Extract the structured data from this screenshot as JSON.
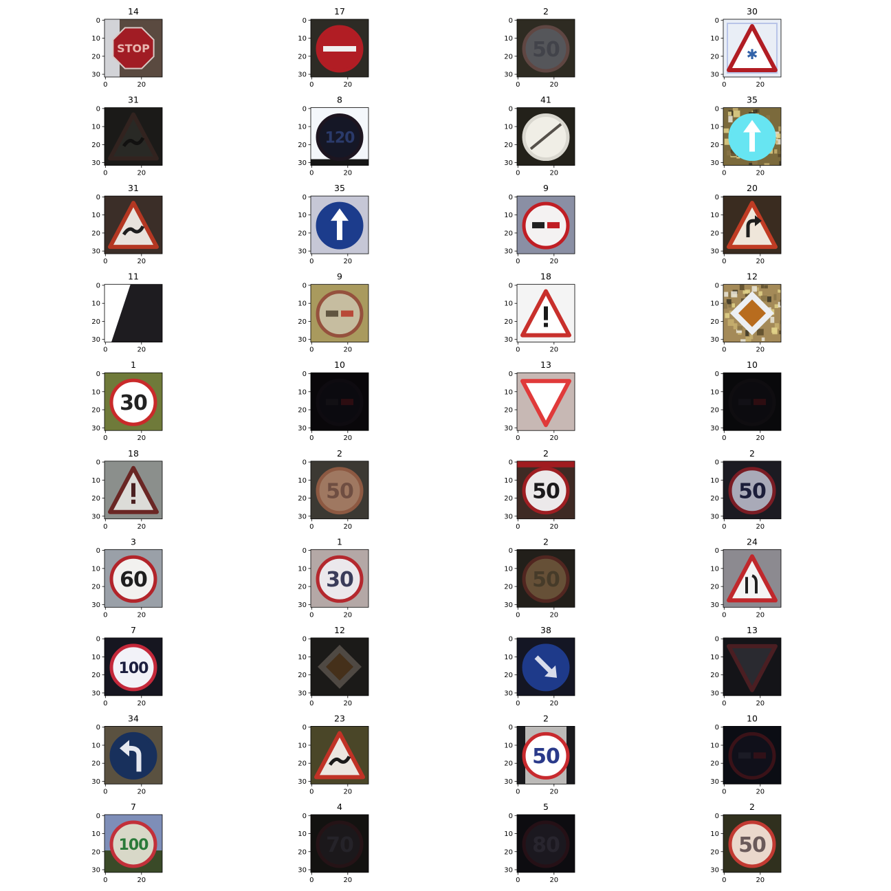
{
  "figure": {
    "axis_ticks": {
      "y": [
        "0",
        "10",
        "20",
        "30"
      ],
      "x": [
        "0",
        "20"
      ]
    },
    "panels": [
      {
        "label": "14",
        "bg": "#5a4a40",
        "shape": "octagon",
        "rim": "#a11c24",
        "fill": "#a11c24",
        "sym": "STOP",
        "symColor": "#e8b6b0",
        "light": true
      },
      {
        "label": "17",
        "bg": "#2d2b25",
        "shape": "circle",
        "rim": "#b11d24",
        "fill": "#b11d24",
        "sym": "bar",
        "symColor": "#efefef"
      },
      {
        "label": "2",
        "bg": "#2e2c23",
        "shape": "circle",
        "rim": "#7a5553",
        "fill": "#6a6d78",
        "sym": "50",
        "symColor": "#4d5160",
        "blur": true
      },
      {
        "label": "30",
        "bg": "#e9eef6",
        "shape": "triangle",
        "rim": "#b11d24",
        "fill": "#ffffff",
        "sym": "✱",
        "symColor": "#3262a8",
        "frame": true
      },
      {
        "label": "31",
        "bg": "#2a2925",
        "shape": "triangle",
        "rim": "#4d3631",
        "fill": "#403f3a",
        "sym": "~",
        "symColor": "#1c1b19",
        "dim": true
      },
      {
        "label": "8",
        "bg": "#f4f7fb",
        "shape": "circle",
        "rim": "#1d1520",
        "fill": "#151726",
        "sym": "120",
        "symColor": "#2a3a6a",
        "base": "#161616"
      },
      {
        "label": "41",
        "bg": "#23211a",
        "shape": "circle",
        "rim": "#d9d7cf",
        "fill": "#f0eee6",
        "sym": "slash",
        "symColor": "#55504a"
      },
      {
        "label": "35",
        "bg": "#7b6a3c",
        "shape": "circle",
        "rim": "#67e5f2",
        "fill": "#67e5f2",
        "sym": "up",
        "symColor": "#ffffff",
        "confetti": true
      },
      {
        "label": "31",
        "bg": "#3b2e28",
        "shape": "triangle",
        "rim": "#b43722",
        "fill": "#e8e2dc",
        "sym": "~",
        "symColor": "#1e1d1d"
      },
      {
        "label": "35",
        "bg": "#c6c7d6",
        "shape": "circle",
        "rim": "#1c3c8c",
        "fill": "#1c3c8c",
        "sym": "up",
        "symColor": "#ffffff"
      },
      {
        "label": "9",
        "bg": "#8a8fa4",
        "shape": "circle",
        "rim": "#c01e24",
        "fill": "#f4f2f2",
        "sym": "cars",
        "symColor": "#202020"
      },
      {
        "label": "20",
        "bg": "#3a2c20",
        "shape": "triangle",
        "rim": "#c03c24",
        "fill": "#efe6da",
        "sym": "turn",
        "symColor": "#1e1e1e"
      },
      {
        "label": "11",
        "bg": "#ffffff",
        "shape": "wedge",
        "rim": "#1e1c20",
        "fill": "#1e1c20",
        "sym": "",
        "symColor": "#1e1c20"
      },
      {
        "label": "9",
        "bg": "#a99a5f",
        "shape": "circle",
        "rim": "#8a2a2c",
        "fill": "#d6cfc4",
        "sym": "cars",
        "symColor": "#3a3030",
        "blur": true
      },
      {
        "label": "18",
        "bg": "#f4f4f4",
        "shape": "triangle",
        "rim": "#c8302c",
        "fill": "#ffffff",
        "sym": "!",
        "symColor": "#1a1a1a"
      },
      {
        "label": "12",
        "bg": "#a48a58",
        "shape": "diamond",
        "rim": "#eceff3",
        "fill": "#b86c1e",
        "sym": "",
        "symColor": "#000",
        "confetti": true
      },
      {
        "label": "1",
        "bg": "#6f7a3a",
        "shape": "circle",
        "rim": "#c92a2a",
        "fill": "#ffffff",
        "sym": "30",
        "symColor": "#222222"
      },
      {
        "label": "10",
        "bg": "#0e0c10",
        "shape": "circle",
        "rim": "#16121a",
        "fill": "#121018",
        "sym": "cars",
        "symColor": "#1c1a20",
        "dim": true
      },
      {
        "label": "13",
        "bg": "#c7b8b4",
        "shape": "yield",
        "rim": "#e03a3a",
        "fill": "#ffffff",
        "sym": "",
        "symColor": "#000"
      },
      {
        "label": "10",
        "bg": "#0f0e12",
        "shape": "circle",
        "rim": "#17141a",
        "fill": "#131218",
        "sym": "cars",
        "symColor": "#1c1a22",
        "dim": true
      },
      {
        "label": "18",
        "bg": "#8b8f8c",
        "shape": "triangle",
        "rim": "#6a2624",
        "fill": "#dcdcd8",
        "sym": "!",
        "symColor": "#4a2020"
      },
      {
        "label": "2",
        "bg": "#3c3a33",
        "shape": "circle",
        "rim": "#b86a4a",
        "fill": "#d59a7a",
        "sym": "50",
        "symColor": "#8a5a4a",
        "blur": true
      },
      {
        "label": "2",
        "bg": "#3e2a24",
        "shape": "circle",
        "rim": "#9e1e22",
        "fill": "#ece9ea",
        "sym": "50",
        "symColor": "#1c1a1c",
        "topbar": "#a01c20"
      },
      {
        "label": "2",
        "bg": "#1c1b22",
        "shape": "circle",
        "rim": "#7a1c24",
        "fill": "#a9aab8",
        "sym": "50",
        "symColor": "#1c1e3a"
      },
      {
        "label": "3",
        "bg": "#9aa0a8",
        "shape": "circle",
        "rim": "#b2242a",
        "fill": "#f2f1ef",
        "sym": "60",
        "symColor": "#1e1e1e"
      },
      {
        "label": "1",
        "bg": "#b4a8a6",
        "shape": "circle",
        "rim": "#b4282e",
        "fill": "#ebe8ec",
        "sym": "30",
        "symColor": "#3a3c5a"
      },
      {
        "label": "2",
        "bg": "#23201b",
        "shape": "circle",
        "rim": "#6a2a24",
        "fill": "#8a6a48",
        "sym": "50",
        "symColor": "#5a4a32",
        "blur": true
      },
      {
        "label": "24",
        "bg": "#8c8a90",
        "shape": "triangle",
        "rim": "#c0282c",
        "fill": "#f4f4f4",
        "sym": "narrow",
        "symColor": "#202020"
      },
      {
        "label": "7",
        "bg": "#161620",
        "shape": "circle",
        "rim": "#c4283a",
        "fill": "#f2f2f8",
        "sym": "100",
        "symColor": "#1c1e3e"
      },
      {
        "label": "12",
        "bg": "#2a2826",
        "shape": "diamond",
        "rim": "#7a7068",
        "fill": "#6a4a28",
        "sym": "",
        "symColor": "#000",
        "dim": true
      },
      {
        "label": "38",
        "bg": "#141624",
        "shape": "circle",
        "rim": "#1e3a8a",
        "fill": "#1e3a8a",
        "sym": "downright",
        "symColor": "#d8dceb"
      },
      {
        "label": "13",
        "bg": "#141418",
        "shape": "yield",
        "rim": "#4a1e22",
        "fill": "#2a2a30",
        "sym": "",
        "symColor": "#000"
      },
      {
        "label": "34",
        "bg": "#5a5140",
        "shape": "circle",
        "rim": "#18305c",
        "fill": "#18305c",
        "sym": "leftturn",
        "symColor": "#e6e9f0"
      },
      {
        "label": "23",
        "bg": "#4a4628",
        "shape": "triangle",
        "rim": "#c03226",
        "fill": "#ebe6e0",
        "sym": "~",
        "symColor": "#1a1a1a"
      },
      {
        "label": "2",
        "bg": "#bcbab8",
        "shape": "circle",
        "rim": "#c82a2e",
        "fill": "#ffffff",
        "sym": "50",
        "symColor": "#2a3a8a",
        "darkedges": true
      },
      {
        "label": "10",
        "bg": "#121420",
        "shape": "circle",
        "rim": "#5a1c26",
        "fill": "#1a1a28",
        "sym": "cars",
        "symColor": "#2a2a3a",
        "dim": true
      },
      {
        "label": "7",
        "bg": "#7e8eb8",
        "shape": "circle",
        "rim": "#c2303a",
        "fill": "#d8d8c8",
        "sym": "100",
        "symColor": "#2a7a3a",
        "ground": "#3a4a28"
      },
      {
        "label": "4",
        "bg": "#1e1c1a",
        "shape": "circle",
        "rim": "#3a1e22",
        "fill": "#2a262a",
        "sym": "70",
        "symColor": "#3a3640",
        "dim": true
      },
      {
        "label": "5",
        "bg": "#14131a",
        "shape": "circle",
        "rim": "#3a1a22",
        "fill": "#2a2630",
        "sym": "80",
        "symColor": "#3e3a48",
        "dim": true
      },
      {
        "label": "2",
        "bg": "#30301e",
        "shape": "circle",
        "rim": "#c23a32",
        "fill": "#ead8cc",
        "sym": "50",
        "symColor": "#6a5a5a"
      }
    ]
  }
}
